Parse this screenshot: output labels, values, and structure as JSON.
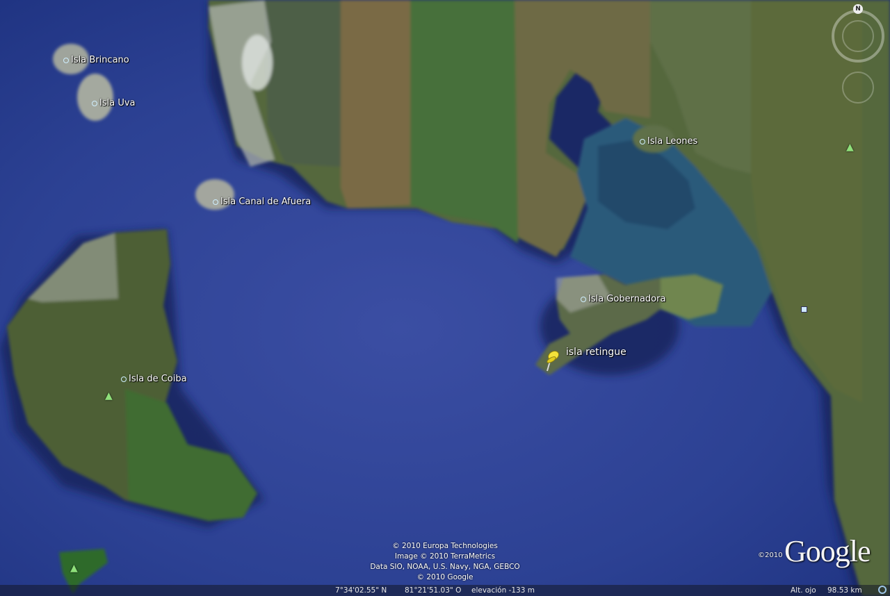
{
  "places": [
    {
      "name": "isla-brincano",
      "label": "Isla Brincano"
    },
    {
      "name": "isla-uva",
      "label": "Isla Uva"
    },
    {
      "name": "isla-canal-de-afuera",
      "label": "Isla Canal de Afuera"
    },
    {
      "name": "isla-leones",
      "label": "Isla Leones"
    },
    {
      "name": "isla-gobernadora",
      "label": "Isla Gobernadora"
    },
    {
      "name": "isla-de-coiba",
      "label": "Isla de Coiba"
    }
  ],
  "placemark": {
    "label": "isla retingue",
    "icon": "yellow-pushpin-icon",
    "color": "#f3e23a"
  },
  "attribution": [
    "© 2010 Europa Technologies",
    "Image © 2010 TerraMetrics",
    "Data SIO, NOAA, U.S. Navy, NGA, GEBCO",
    "© 2010 Google"
  ],
  "status": {
    "latitude": "7°34'02.55\" N",
    "longitude": "81°21'51.03\" O",
    "elevation": "elevación -133 m",
    "eye_alt_label": "Alt. ojo",
    "eye_alt_value": "98.53 km"
  },
  "logo": {
    "text": "Google",
    "year": "©2010"
  },
  "compass": {
    "north_label": "N"
  },
  "colors": {
    "ocean": "#2b3f8f",
    "land": "#4f6a3a",
    "shallow": "#3b6d8a"
  }
}
